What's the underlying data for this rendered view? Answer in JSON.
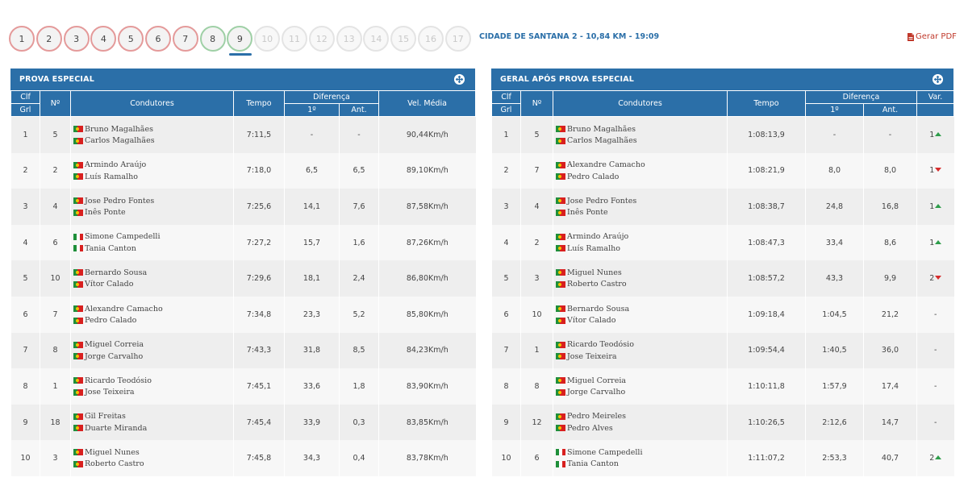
{
  "stages": [
    {
      "label": "1",
      "status": "done-red"
    },
    {
      "label": "2",
      "status": "done-red"
    },
    {
      "label": "3",
      "status": "done-red"
    },
    {
      "label": "4",
      "status": "done-red"
    },
    {
      "label": "5",
      "status": "done-red"
    },
    {
      "label": "6",
      "status": "done-red"
    },
    {
      "label": "7",
      "status": "done-red"
    },
    {
      "label": "8",
      "status": "done-green"
    },
    {
      "label": "9",
      "status": "done-green",
      "active": true
    },
    {
      "label": "10",
      "status": "future"
    },
    {
      "label": "11",
      "status": "future"
    },
    {
      "label": "12",
      "status": "future"
    },
    {
      "label": "13",
      "status": "future"
    },
    {
      "label": "14",
      "status": "future"
    },
    {
      "label": "15",
      "status": "future"
    },
    {
      "label": "16",
      "status": "future"
    },
    {
      "label": "17",
      "status": "future"
    }
  ],
  "stage_info": "CIDADE DE SANTANA 2 - 10,84 KM - 19:09",
  "pdf_label": "Gerar PDF",
  "colors": {
    "header_bg": "#2b6fa8",
    "arrow_up": "#2e9d4b",
    "arrow_down": "#d62c2c",
    "pdf": "#c0392b"
  },
  "left": {
    "title": "PROVA ESPECIAL",
    "headers": {
      "clf": "Clf",
      "grl": "Grl",
      "num": "Nº",
      "drivers": "Condutores",
      "time": "Tempo",
      "diff": "Diferença",
      "first": "1º",
      "prev": "Ant.",
      "speed": "Vel. Média"
    },
    "rows": [
      {
        "pos": "1",
        "num": "5",
        "d1": "Bruno Magalhães",
        "f1": "pt",
        "d2": "Carlos Magalhães",
        "f2": "pt",
        "time": "7:11,5",
        "first": "-",
        "prev": "-",
        "speed": "90,44Km/h"
      },
      {
        "pos": "2",
        "num": "2",
        "d1": "Armindo Araújo",
        "f1": "pt",
        "d2": "Luís Ramalho",
        "f2": "pt",
        "time": "7:18,0",
        "first": "6,5",
        "prev": "6,5",
        "speed": "89,10Km/h"
      },
      {
        "pos": "3",
        "num": "4",
        "d1": "Jose Pedro Fontes",
        "f1": "pt",
        "d2": "Inês Ponte",
        "f2": "pt",
        "time": "7:25,6",
        "first": "14,1",
        "prev": "7,6",
        "speed": "87,58Km/h"
      },
      {
        "pos": "4",
        "num": "6",
        "d1": "Simone Campedelli",
        "f1": "it",
        "d2": "Tania Canton",
        "f2": "it",
        "time": "7:27,2",
        "first": "15,7",
        "prev": "1,6",
        "speed": "87,26Km/h"
      },
      {
        "pos": "5",
        "num": "10",
        "d1": "Bernardo Sousa",
        "f1": "pt",
        "d2": "Vítor Calado",
        "f2": "pt",
        "time": "7:29,6",
        "first": "18,1",
        "prev": "2,4",
        "speed": "86,80Km/h"
      },
      {
        "pos": "6",
        "num": "7",
        "d1": "Alexandre Camacho",
        "f1": "pt",
        "d2": "Pedro Calado",
        "f2": "pt",
        "time": "7:34,8",
        "first": "23,3",
        "prev": "5,2",
        "speed": "85,80Km/h"
      },
      {
        "pos": "7",
        "num": "8",
        "d1": "Miguel Correia",
        "f1": "pt",
        "d2": "Jorge Carvalho",
        "f2": "pt",
        "time": "7:43,3",
        "first": "31,8",
        "prev": "8,5",
        "speed": "84,23Km/h"
      },
      {
        "pos": "8",
        "num": "1",
        "d1": "Ricardo Teodósio",
        "f1": "pt",
        "d2": "Jose Teixeira",
        "f2": "pt",
        "time": "7:45,1",
        "first": "33,6",
        "prev": "1,8",
        "speed": "83,90Km/h"
      },
      {
        "pos": "9",
        "num": "18",
        "d1": "Gil Freitas",
        "f1": "pt",
        "d2": "Duarte Miranda",
        "f2": "pt",
        "time": "7:45,4",
        "first": "33,9",
        "prev": "0,3",
        "speed": "83,85Km/h"
      },
      {
        "pos": "10",
        "num": "3",
        "d1": "Miguel Nunes",
        "f1": "pt",
        "d2": "Roberto Castro",
        "f2": "pt",
        "time": "7:45,8",
        "first": "34,3",
        "prev": "0,4",
        "speed": "83,78Km/h"
      }
    ]
  },
  "right": {
    "title": "GERAL APÓS PROVA ESPECIAL",
    "headers": {
      "clf": "Clf",
      "grl": "Grl",
      "num": "Nº",
      "drivers": "Condutores",
      "time": "Tempo",
      "diff": "Diferença",
      "first": "1º",
      "prev": "Ant.",
      "var": "Var."
    },
    "rows": [
      {
        "pos": "1",
        "num": "5",
        "d1": "Bruno Magalhães",
        "f1": "pt",
        "d2": "Carlos Magalhães",
        "f2": "pt",
        "time": "1:08:13,9",
        "first": "-",
        "prev": "-",
        "var": "1",
        "dir": "up"
      },
      {
        "pos": "2",
        "num": "7",
        "d1": "Alexandre Camacho",
        "f1": "pt",
        "d2": "Pedro Calado",
        "f2": "pt",
        "time": "1:08:21,9",
        "first": "8,0",
        "prev": "8,0",
        "var": "1",
        "dir": "down"
      },
      {
        "pos": "3",
        "num": "4",
        "d1": "Jose Pedro Fontes",
        "f1": "pt",
        "d2": "Inês Ponte",
        "f2": "pt",
        "time": "1:08:38,7",
        "first": "24,8",
        "prev": "16,8",
        "var": "1",
        "dir": "up"
      },
      {
        "pos": "4",
        "num": "2",
        "d1": "Armindo Araújo",
        "f1": "pt",
        "d2": "Luís Ramalho",
        "f2": "pt",
        "time": "1:08:47,3",
        "first": "33,4",
        "prev": "8,6",
        "var": "1",
        "dir": "up"
      },
      {
        "pos": "5",
        "num": "3",
        "d1": "Miguel Nunes",
        "f1": "pt",
        "d2": "Roberto Castro",
        "f2": "pt",
        "time": "1:08:57,2",
        "first": "43,3",
        "prev": "9,9",
        "var": "2",
        "dir": "down"
      },
      {
        "pos": "6",
        "num": "10",
        "d1": "Bernardo Sousa",
        "f1": "pt",
        "d2": "Vítor Calado",
        "f2": "pt",
        "time": "1:09:18,4",
        "first": "1:04,5",
        "prev": "21,2",
        "var": "-",
        "dir": ""
      },
      {
        "pos": "7",
        "num": "1",
        "d1": "Ricardo Teodósio",
        "f1": "pt",
        "d2": "Jose Teixeira",
        "f2": "pt",
        "time": "1:09:54,4",
        "first": "1:40,5",
        "prev": "36,0",
        "var": "-",
        "dir": ""
      },
      {
        "pos": "8",
        "num": "8",
        "d1": "Miguel Correia",
        "f1": "pt",
        "d2": "Jorge Carvalho",
        "f2": "pt",
        "time": "1:10:11,8",
        "first": "1:57,9",
        "prev": "17,4",
        "var": "-",
        "dir": ""
      },
      {
        "pos": "9",
        "num": "12",
        "d1": "Pedro Meireles",
        "f1": "pt",
        "d2": "Pedro Alves",
        "f2": "pt",
        "time": "1:10:26,5",
        "first": "2:12,6",
        "prev": "14,7",
        "var": "-",
        "dir": ""
      },
      {
        "pos": "10",
        "num": "6",
        "d1": "Simone Campedelli",
        "f1": "it",
        "d2": "Tania Canton",
        "f2": "it",
        "time": "1:11:07,2",
        "first": "2:53,3",
        "prev": "40,7",
        "var": "2",
        "dir": "up"
      }
    ]
  }
}
